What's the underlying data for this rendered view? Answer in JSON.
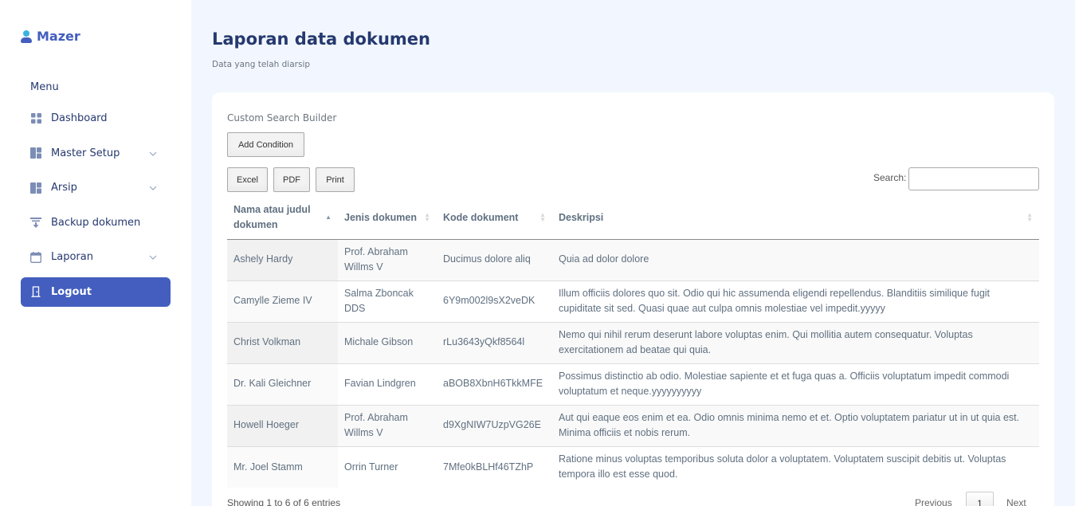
{
  "sidebar": {
    "brand": "Mazer",
    "menu_title": "Menu",
    "items": [
      {
        "label": "Dashboard",
        "icon": "grid-icon",
        "has_submenu": false
      },
      {
        "label": "Master Setup",
        "icon": "layout-icon",
        "has_submenu": true
      },
      {
        "label": "Arsip",
        "icon": "layout-icon",
        "has_submenu": true
      },
      {
        "label": "Backup dokumen",
        "icon": "backup-icon",
        "has_submenu": false
      },
      {
        "label": "Laporan",
        "icon": "calendar-icon",
        "has_submenu": true
      },
      {
        "label": "Logout",
        "icon": "door-icon",
        "has_submenu": false,
        "active": true
      }
    ]
  },
  "header": {
    "title": "Laporan data dokumen",
    "subtitle": "Data yang telah diarsip"
  },
  "toolbar": {
    "custom_search_title": "Custom Search Builder",
    "add_condition": "Add Condition",
    "excel": "Excel",
    "pdf": "PDF",
    "print": "Print",
    "search_label": "Search:",
    "search_value": ""
  },
  "table": {
    "columns": [
      "Nama atau judul dokumen",
      "Jenis dokumen",
      "Kode dokument",
      "Deskripsi"
    ],
    "rows": [
      [
        "Ashely Hardy",
        "Prof. Abraham Willms V",
        "Ducimus dolore aliq",
        "Quia ad dolor dolore"
      ],
      [
        "Camylle Zieme IV",
        "Salma Zboncak DDS",
        "6Y9m002l9sX2veDK",
        "Illum officiis dolores quo sit. Odio qui hic assumenda eligendi repellendus. Blanditiis similique fugit cupiditate sit sed. Quasi quae aut culpa omnis molestiae vel impedit.yyyyy"
      ],
      [
        "Christ Volkman",
        "Michale Gibson",
        "rLu3643yQkf8564l",
        "Nemo qui nihil rerum deserunt labore voluptas enim. Qui mollitia autem consequatur. Voluptas exercitationem ad beatae qui quia."
      ],
      [
        "Dr. Kali Gleichner",
        "Favian Lindgren",
        "aBOB8XbnH6TkkMFE",
        "Possimus distinctio ab odio. Molestiae sapiente et et fuga quas a. Officiis voluptatum impedit commodi voluptatum et neque.yyyyyyyyyy"
      ],
      [
        "Howell Hoeger",
        "Prof. Abraham Willms V",
        "d9XgNIW7UzpVG26E",
        "Aut qui eaque eos enim et ea. Odio omnis minima nemo et et. Optio voluptatem pariatur ut in ut quia est. Minima officiis et nobis rerum."
      ],
      [
        "Mr. Joel Stamm",
        "Orrin Turner",
        "7Mfe0kBLHf46TZhP",
        "Ratione minus voluptas temporibus soluta dolor a voluptatem. Voluptatem suscipit debitis ut. Voluptas tempora illo est esse quod."
      ]
    ]
  },
  "footer": {
    "info": "Showing 1 to 6 of 6 entries",
    "previous": "Previous",
    "page": "1",
    "next": "Next"
  },
  "colors": {
    "primary": "#435ebe",
    "background": "#f2f7ff",
    "text": "#25396f"
  }
}
